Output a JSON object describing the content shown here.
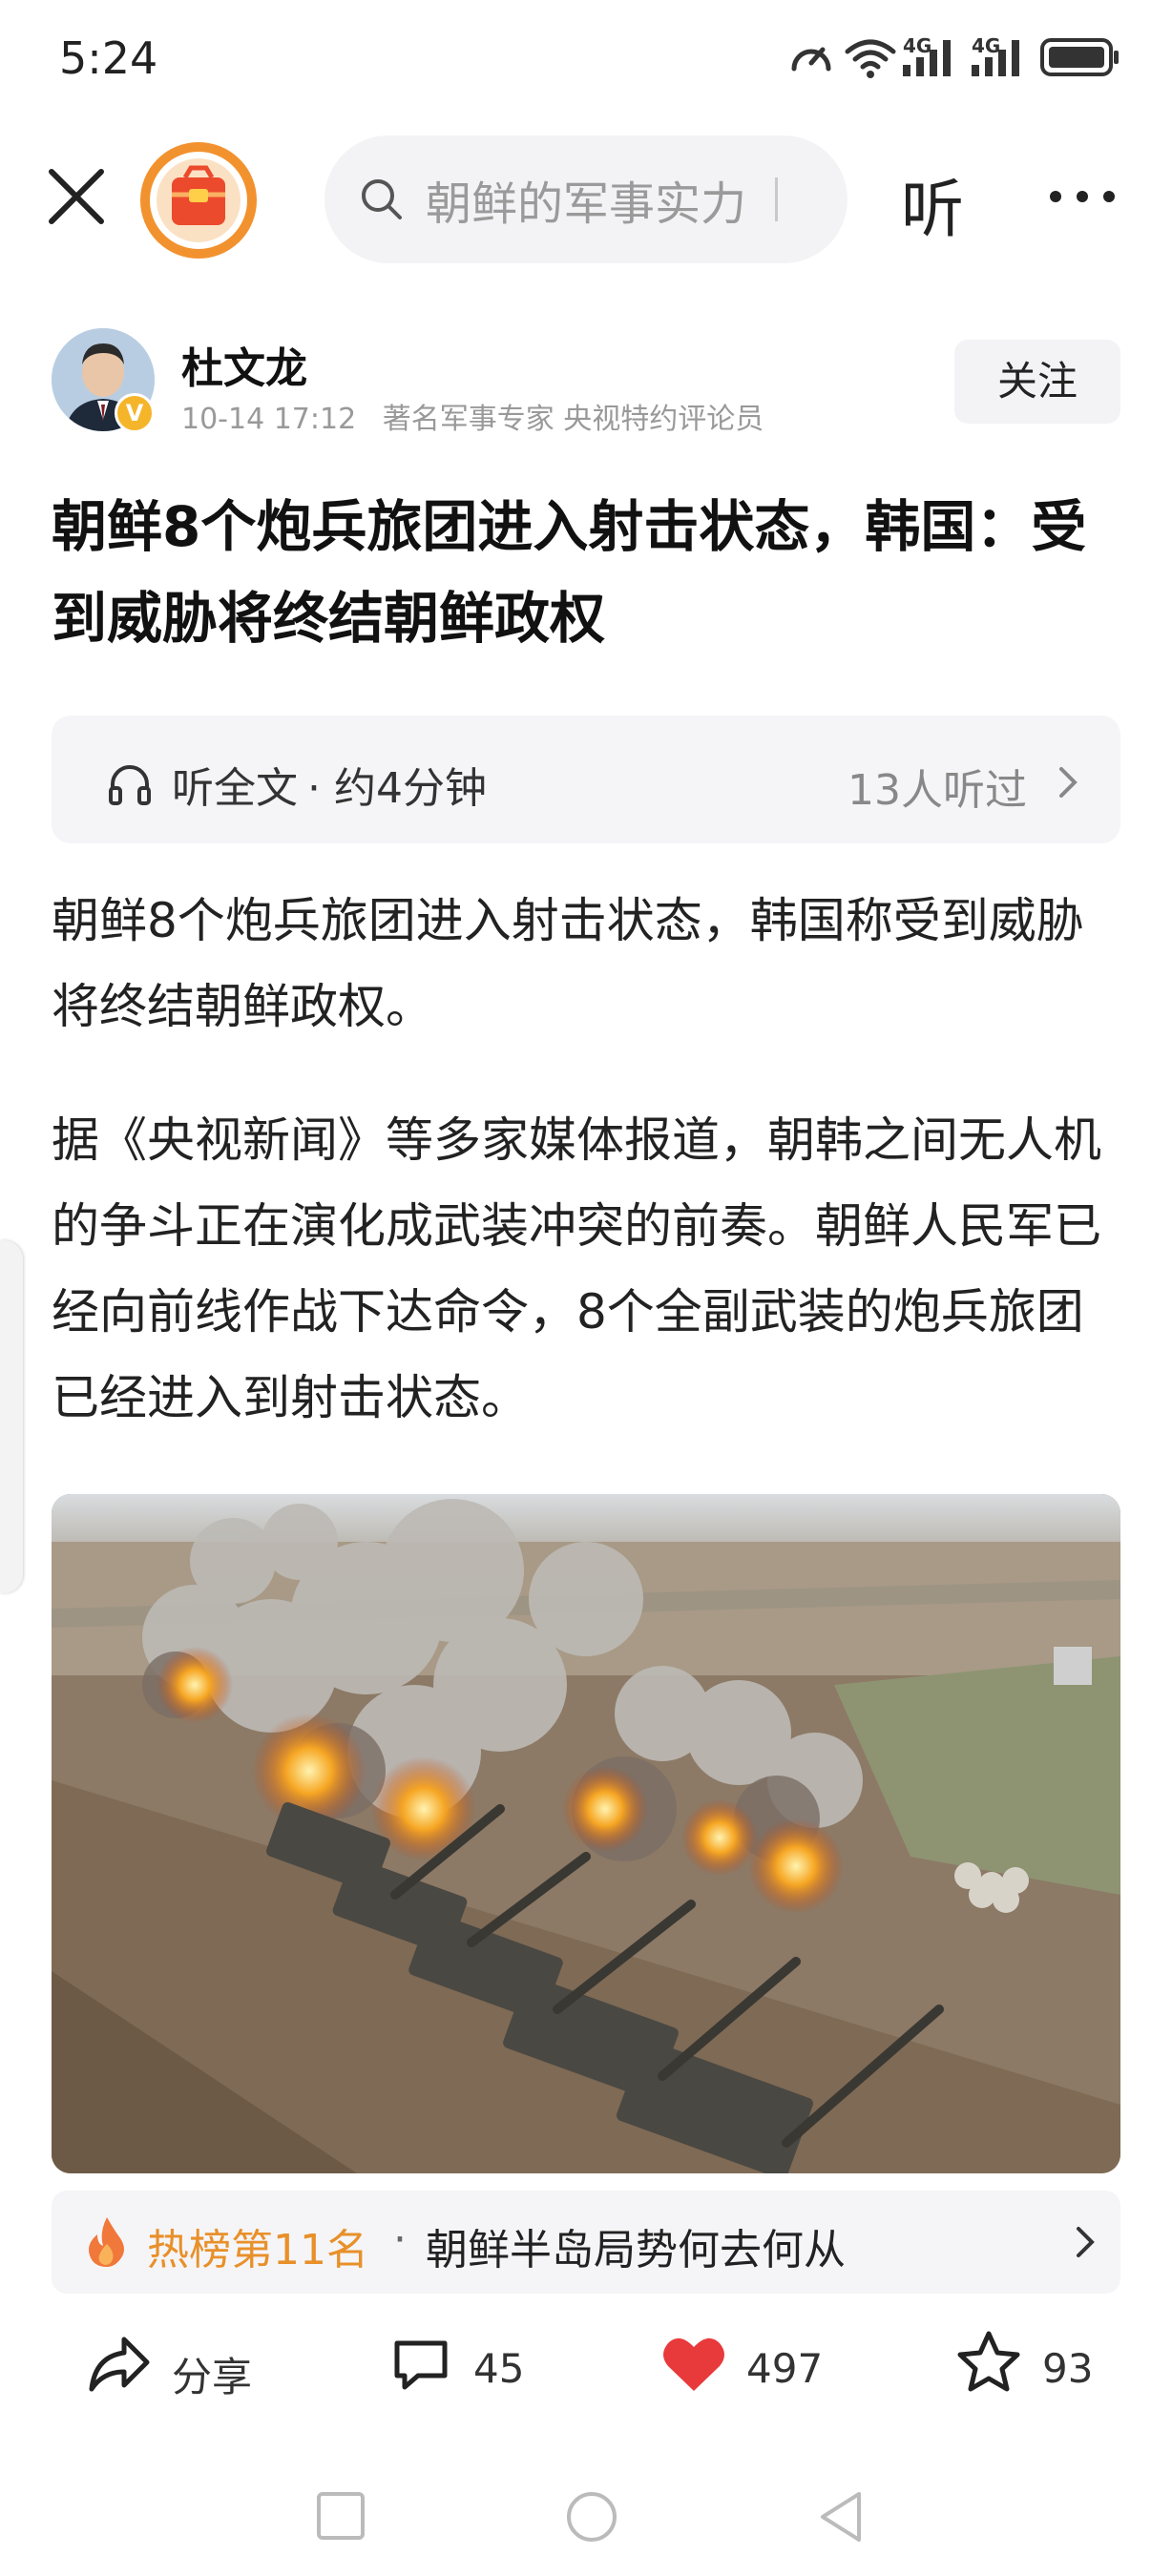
{
  "status_bar": {
    "time": "5:24",
    "net1": "4G",
    "net2": "4G",
    "icons": [
      "data-saver-icon",
      "wifi-icon",
      "signal-icon",
      "signal-icon",
      "battery-icon"
    ]
  },
  "top_bar": {
    "search_placeholder": "朝鲜的军事实力",
    "listen_label": "听",
    "icons": [
      "close-icon",
      "red-bag-icon",
      "search-icon",
      "more-icon"
    ]
  },
  "author": {
    "name": "杜文龙",
    "time": "10-14 17:12",
    "description": "著名军事专家 央视特约评论员",
    "follow_label": "关注",
    "verified_mark": "V"
  },
  "article": {
    "title": "朝鲜8个炮兵旅团进入射击状态，韩国：受到威胁将终结朝鲜政权",
    "listen_full": "听全文",
    "listen_duration": "· 约4分钟",
    "listen_count": "13人听过",
    "paragraphs": [
      "朝鲜8个炮兵旅团进入射击状态，韩国称受到威胁将终结朝鲜政权。",
      "据《央视新闻》等多家媒体报道，朝韩之间无人机的争斗正在演化成武装冲突的前奏。朝鲜人民军已经向前线作战下达命令，8个全副武装的炮兵旅团已经进入到射击状态。"
    ]
  },
  "hot_topic": {
    "rank": "热榜第11名",
    "separator": "·",
    "topic": "朝鲜半岛局势何去何从"
  },
  "actions": {
    "share_label": "分享",
    "comments": "45",
    "likes": "497",
    "favorites": "93"
  },
  "colors": {
    "accent_orange": "#e8902a",
    "like_red": "#e8393b",
    "verified_gold": "#f5b52a"
  }
}
